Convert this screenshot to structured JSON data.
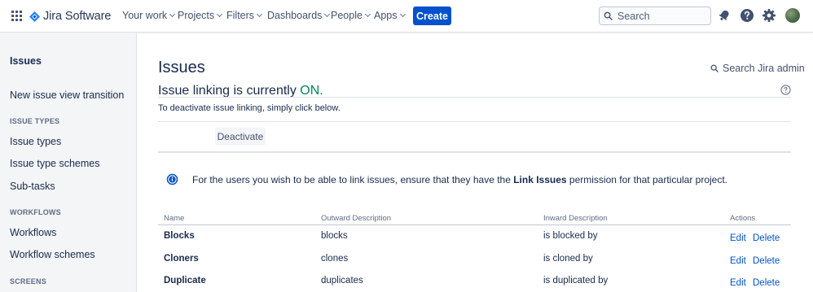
{
  "topnav": {
    "product_name": "Jira Software",
    "items": [
      {
        "label": "Your work"
      },
      {
        "label": "Projects"
      },
      {
        "label": "Filters"
      },
      {
        "label": "Dashboards"
      },
      {
        "label": "People"
      },
      {
        "label": "Apps"
      }
    ],
    "create_label": "Create",
    "search_placeholder": "Search",
    "icons": [
      "notifications-icon",
      "help-icon",
      "settings-icon"
    ]
  },
  "sidebar": {
    "title": "Issues",
    "link_transition": "New issue view transition",
    "section_issue_types": "ISSUE TYPES",
    "issue_types": [
      {
        "label": "Issue types"
      },
      {
        "label": "Issue type schemes"
      },
      {
        "label": "Sub-tasks"
      }
    ],
    "section_workflows": "WORKFLOWS",
    "workflows": [
      {
        "label": "Workflows"
      },
      {
        "label": "Workflow schemes"
      }
    ],
    "section_screens": "SCREENS"
  },
  "main": {
    "title": "Issues",
    "admin_search": "Search Jira admin",
    "heading_prefix": "Issue linking is currently ",
    "heading_status": "ON.",
    "instruction": "To deactivate issue linking, simply click below.",
    "deactivate_label": "Deactivate",
    "info": {
      "before": "For the users you wish to be able to link issues, ensure that they have the ",
      "bold": "Link Issues",
      "after": " permission for that particular project."
    },
    "table": {
      "headers": {
        "name": "Name",
        "outward": "Outward Description",
        "inward": "Inward Description",
        "actions": "Actions"
      },
      "rows": [
        {
          "name": "Blocks",
          "outward": "blocks",
          "inward": "is blocked by",
          "edit": "Edit",
          "delete": "Delete"
        },
        {
          "name": "Cloners",
          "outward": "clones",
          "inward": "is cloned by",
          "edit": "Edit",
          "delete": "Delete"
        },
        {
          "name": "Duplicate",
          "outward": "duplicates",
          "inward": "is duplicated by",
          "edit": "Edit",
          "delete": "Delete"
        }
      ]
    }
  },
  "colors": {
    "brand_blue": "#0052cc",
    "status_on": "#00875a",
    "sidebar_bg": "#f4f5f7",
    "text": "#172b4d"
  }
}
